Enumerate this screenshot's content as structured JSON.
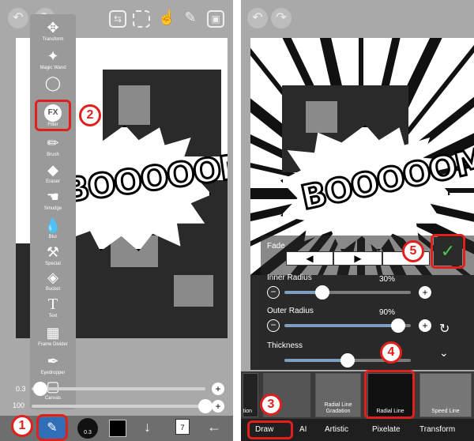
{
  "left_panel": {
    "tools": [
      {
        "name": "transform",
        "label": "Transform",
        "icon": "move-icon"
      },
      {
        "name": "magic-wand",
        "label": "Magic Wand",
        "icon": "magic-wand-icon"
      },
      {
        "name": "lasso",
        "label": "",
        "icon": "lasso-icon"
      },
      {
        "name": "filter",
        "label": "Filter",
        "icon": "fx-icon"
      },
      {
        "name": "brush",
        "label": "Brush",
        "icon": "brush-icon"
      },
      {
        "name": "eraser",
        "label": "Eraser",
        "icon": "eraser-icon"
      },
      {
        "name": "smudge",
        "label": "Smudge",
        "icon": "smudge-icon"
      },
      {
        "name": "blur",
        "label": "Blur",
        "icon": "blur-icon"
      },
      {
        "name": "special",
        "label": "Special",
        "icon": "special-icon"
      },
      {
        "name": "bucket",
        "label": "Bucket",
        "icon": "bucket-icon"
      },
      {
        "name": "text",
        "label": "Text",
        "icon": "text-icon"
      },
      {
        "name": "frame-divider",
        "label": "Frame Divider",
        "icon": "frame-divider-icon"
      },
      {
        "name": "eyedropper",
        "label": "Eyedropper",
        "icon": "eyedropper-icon"
      },
      {
        "name": "canvas",
        "label": "Canvas",
        "icon": "canvas-icon"
      }
    ],
    "brush_size": "0.3",
    "opacity": "100",
    "size_fraction": 0.05,
    "opacity_fraction": 1.0,
    "layer_count": "7",
    "brush_indicator": "0.3"
  },
  "right_panel": {
    "fade_label": "Fade",
    "fade_options": [
      "◀",
      "▶",
      ""
    ],
    "inner_radius_label": "Inner Radius",
    "inner_radius_value": "30%",
    "inner_radius_fraction": 0.3,
    "outer_radius_label": "Outer Radius",
    "outer_radius_value": "90%",
    "outer_radius_fraction": 0.9,
    "thickness_label": "Thickness",
    "thickness_fraction": 0.5,
    "filters": [
      {
        "label": "Concentric Gradation",
        "shown_label": "entric adation"
      },
      {
        "label": "Radial Line Gradation",
        "shown_label": "Radial Line Gradation"
      },
      {
        "label": "Radial Line",
        "shown_label": "Radial Line"
      },
      {
        "label": "Speed Line",
        "shown_label": "Speed Line"
      }
    ],
    "categories": [
      "Draw",
      "AI",
      "Artistic",
      "Pixelate",
      "Transform"
    ]
  },
  "annotations": {
    "steps": [
      "1",
      "2",
      "3",
      "4",
      "5"
    ],
    "accent": "#e0201c"
  },
  "art_text": "BOOOOOM!!"
}
